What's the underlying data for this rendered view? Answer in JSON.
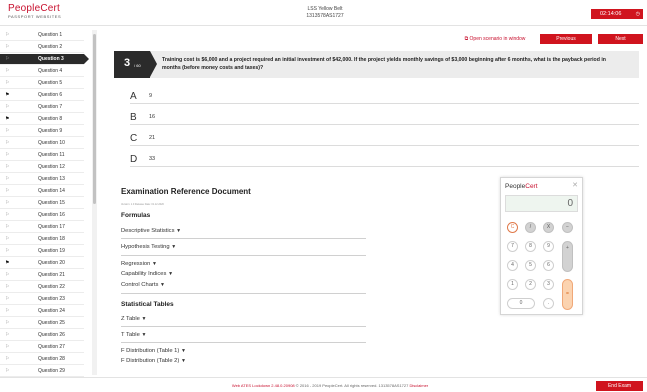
{
  "header": {
    "brand": "PeopleCert",
    "brand_sub": "PASSPORT WEBSITES",
    "exam_title": "LSS Yellow Belt",
    "exam_code": "1313578AS1727",
    "timer": "02:14:06"
  },
  "sidebar": {
    "items": [
      {
        "label": "Question 1",
        "flagged": false
      },
      {
        "label": "Question 2",
        "flagged": false
      },
      {
        "label": "Question 3",
        "flagged": false,
        "active": true
      },
      {
        "label": "Question 4",
        "flagged": false
      },
      {
        "label": "Question 5",
        "flagged": false
      },
      {
        "label": "Question 6",
        "flagged": true
      },
      {
        "label": "Question 7",
        "flagged": false
      },
      {
        "label": "Question 8",
        "flagged": true
      },
      {
        "label": "Question 9",
        "flagged": false
      },
      {
        "label": "Question 10",
        "flagged": false
      },
      {
        "label": "Question 11",
        "flagged": false
      },
      {
        "label": "Question 12",
        "flagged": false
      },
      {
        "label": "Question 13",
        "flagged": false
      },
      {
        "label": "Question 14",
        "flagged": false
      },
      {
        "label": "Question 15",
        "flagged": false
      },
      {
        "label": "Question 16",
        "flagged": false
      },
      {
        "label": "Question 17",
        "flagged": false
      },
      {
        "label": "Question 18",
        "flagged": false
      },
      {
        "label": "Question 19",
        "flagged": false
      },
      {
        "label": "Question 20",
        "flagged": true
      },
      {
        "label": "Question 21",
        "flagged": false
      },
      {
        "label": "Question 22",
        "flagged": false
      },
      {
        "label": "Question 23",
        "flagged": false
      },
      {
        "label": "Question 24",
        "flagged": false
      },
      {
        "label": "Question 25",
        "flagged": false
      },
      {
        "label": "Question 26",
        "flagged": false
      },
      {
        "label": "Question 27",
        "flagged": false
      },
      {
        "label": "Question 28",
        "flagged": false
      },
      {
        "label": "Question 29",
        "flagged": false
      }
    ]
  },
  "toolbar": {
    "open_new_window": "Open scenario in window",
    "previous": "Previous",
    "next": "Next"
  },
  "question": {
    "number": "3",
    "total": "/ 60",
    "text": "Training cost is $6,000 and a project required an initial investment of $42,000. If the project yields monthly savings of $3,000 beginning after 6 months, what is the payback period in months (before money costs and taxes)?"
  },
  "answers": [
    {
      "letter": "A",
      "value": "9"
    },
    {
      "letter": "B",
      "value": "16"
    },
    {
      "letter": "C",
      "value": "21"
    },
    {
      "letter": "D",
      "value": "33"
    }
  ],
  "reference": {
    "title": "Examination Reference Document",
    "subtitle": "Version: 1.0 Release Date: 01.12.2020",
    "formulas_heading": "Formulas",
    "formulas": [
      "Descriptive Statistics",
      "Hypothesis Testing",
      "Regression",
      "Capability Indices",
      "Control Charts"
    ],
    "tables_heading": "Statistical Tables",
    "tables": [
      "Z Table",
      "T Table",
      "F Distribution (Table 1)",
      "F Distribution (Table 2)"
    ]
  },
  "calculator": {
    "brand_a": "People",
    "brand_b": "Cert",
    "display": "0",
    "keys": [
      "C",
      "/",
      "X",
      "−",
      "7",
      "8",
      "9",
      "+",
      "4",
      "5",
      "6",
      "1",
      "2",
      "3",
      "=",
      "0",
      "."
    ]
  },
  "footer": {
    "text_prefix": "Web ATES Lockdown 2.48.0.20908",
    "text_middle": " © 2016 - 2019 PeopleCert. All rights reserved. 1313578AS1727 ",
    "disclaimer": "Disclaimer",
    "end_exam": "End Exam"
  },
  "colors": {
    "accent": "#d0141e",
    "dark": "#2b2b2b",
    "banner": "#ececec"
  },
  "icons": {
    "flag": "flag-icon",
    "close": "close-icon",
    "timer": "clock-icon"
  }
}
